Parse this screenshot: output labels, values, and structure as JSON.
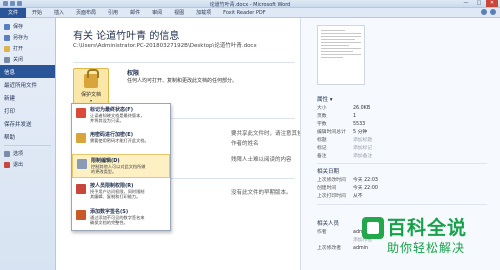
{
  "window": {
    "title": "论道竹叶青.docx - Microsoft Word",
    "controls": [
      "—",
      "□",
      "✕"
    ]
  },
  "ribbon": {
    "file_tab": "文件",
    "tabs": [
      "开始",
      "插入",
      "页面布局",
      "引用",
      "邮件",
      "审阅",
      "视图",
      "加载项",
      "Foxit Reader PDF"
    ]
  },
  "nav": {
    "items": [
      {
        "label": "保存",
        "icon": "save-icon"
      },
      {
        "label": "另存为",
        "icon": "save-as-icon"
      },
      {
        "label": "打开",
        "icon": "open-folder-icon"
      },
      {
        "label": "关闭",
        "icon": "close-doc-icon"
      }
    ],
    "sections": [
      "信息",
      "最近所用文件",
      "新建",
      "打印",
      "保存并发送",
      "帮助"
    ],
    "bottom": [
      {
        "label": "选项",
        "icon": "options-icon"
      },
      {
        "label": "退出",
        "icon": "exit-icon"
      }
    ]
  },
  "info": {
    "title": "有关 论道竹叶青 的信息",
    "path": "C:\\Users\\Administrator.PC-20180327192B\\Desktop\\论道竹叶青.docx",
    "protect_button": "保护文档",
    "protect_arrow": "▾",
    "permissions_heading": "权限",
    "permissions_desc": "任何人均可打开、复制和更改此文档的任何部分。",
    "bg_prepare_1": "要共享此文件时，请注意其包含以下内容",
    "bg_prepare_2": "作者的姓名",
    "bg_prepare_3": "残障人士难以阅读的内容",
    "bg_versions": "没有此文件的早期版本。"
  },
  "protect_menu": [
    {
      "title": "标记为最终状态(F)",
      "desc1": "让读者知晓文档是最终版本，",
      "desc2": "并将其设为只读。",
      "icon": "final-mark-icon"
    },
    {
      "title": "用密码进行加密(E)",
      "desc1": "需要使用密码才能打开此文档。",
      "desc2": "",
      "icon": "encrypt-icon"
    },
    {
      "title": "限制编辑(D)",
      "desc1": "控制其他人可以对此文档所做",
      "desc2": "的更改类型。",
      "icon": "restrict-editing-icon"
    },
    {
      "title": "按人员限制权限(R)",
      "desc1": "授予用户访问权限，同时限制",
      "desc2": "其编辑、复制和打印能力。",
      "icon": "restrict-people-icon"
    },
    {
      "title": "添加数字签名(S)",
      "desc1": "通过添加不可见的数字签名来",
      "desc2": "确保文档的完整性。",
      "icon": "digital-signature-icon"
    }
  ],
  "properties": {
    "heading": "属性 ▾",
    "rows": [
      {
        "key": "大小",
        "value": "26.0KB",
        "muted": false
      },
      {
        "key": "页数",
        "value": "1",
        "muted": false
      },
      {
        "key": "字数",
        "value": "5533",
        "muted": false
      },
      {
        "key": "编辑时间总计",
        "value": "5 分钟",
        "muted": false
      },
      {
        "key": "标题",
        "value": "添加标题",
        "muted": true
      },
      {
        "key": "标记",
        "value": "添加标记",
        "muted": true
      },
      {
        "key": "备注",
        "value": "添加备注",
        "muted": true
      }
    ],
    "dates_heading": "相关日期",
    "dates": [
      {
        "key": "上次修改时间",
        "value": "今天 22:03"
      },
      {
        "key": "创建时间",
        "value": "今天 22:00"
      },
      {
        "key": "上次打印时间",
        "value": "从不"
      }
    ],
    "people_heading": "相关人员",
    "people": [
      {
        "key": "作者",
        "value": "admin",
        "muted": false
      },
      {
        "key": "",
        "value": "添加作者",
        "muted": true
      },
      {
        "key": "上次修改者",
        "value": "admin",
        "muted": false
      }
    ]
  },
  "watermark": {
    "big": "百科全说",
    "small": "助你轻松解决"
  }
}
